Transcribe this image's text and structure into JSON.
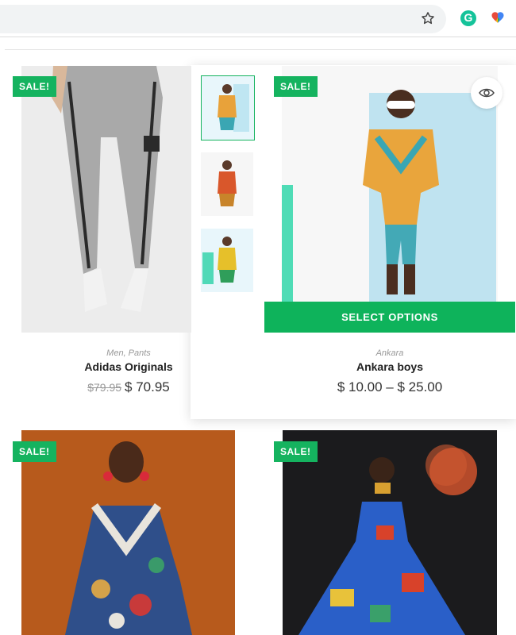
{
  "browser": {
    "star_icon": "star-icon",
    "extensions": [
      "grammarly-icon",
      "extension-heart-icon"
    ],
    "grammarly_letter": "G"
  },
  "products": [
    {
      "sale_badge": "SALE!",
      "categories": "Men, Pants",
      "title": "Adidas Originals",
      "old_price": "$79.95",
      "price": "$ 70.95"
    },
    {
      "sale_badge": "SALE!",
      "categories": "Ankara",
      "title": "Ankara boys",
      "price": "$ 10.00 – $ 25.00",
      "select_label": "SELECT OPTIONS",
      "quick_view_icon": "eye-icon",
      "thumbnails": 3
    },
    {
      "sale_badge": "SALE!"
    },
    {
      "sale_badge": "SALE!"
    }
  ],
  "colors": {
    "accent": "#15b35f"
  }
}
